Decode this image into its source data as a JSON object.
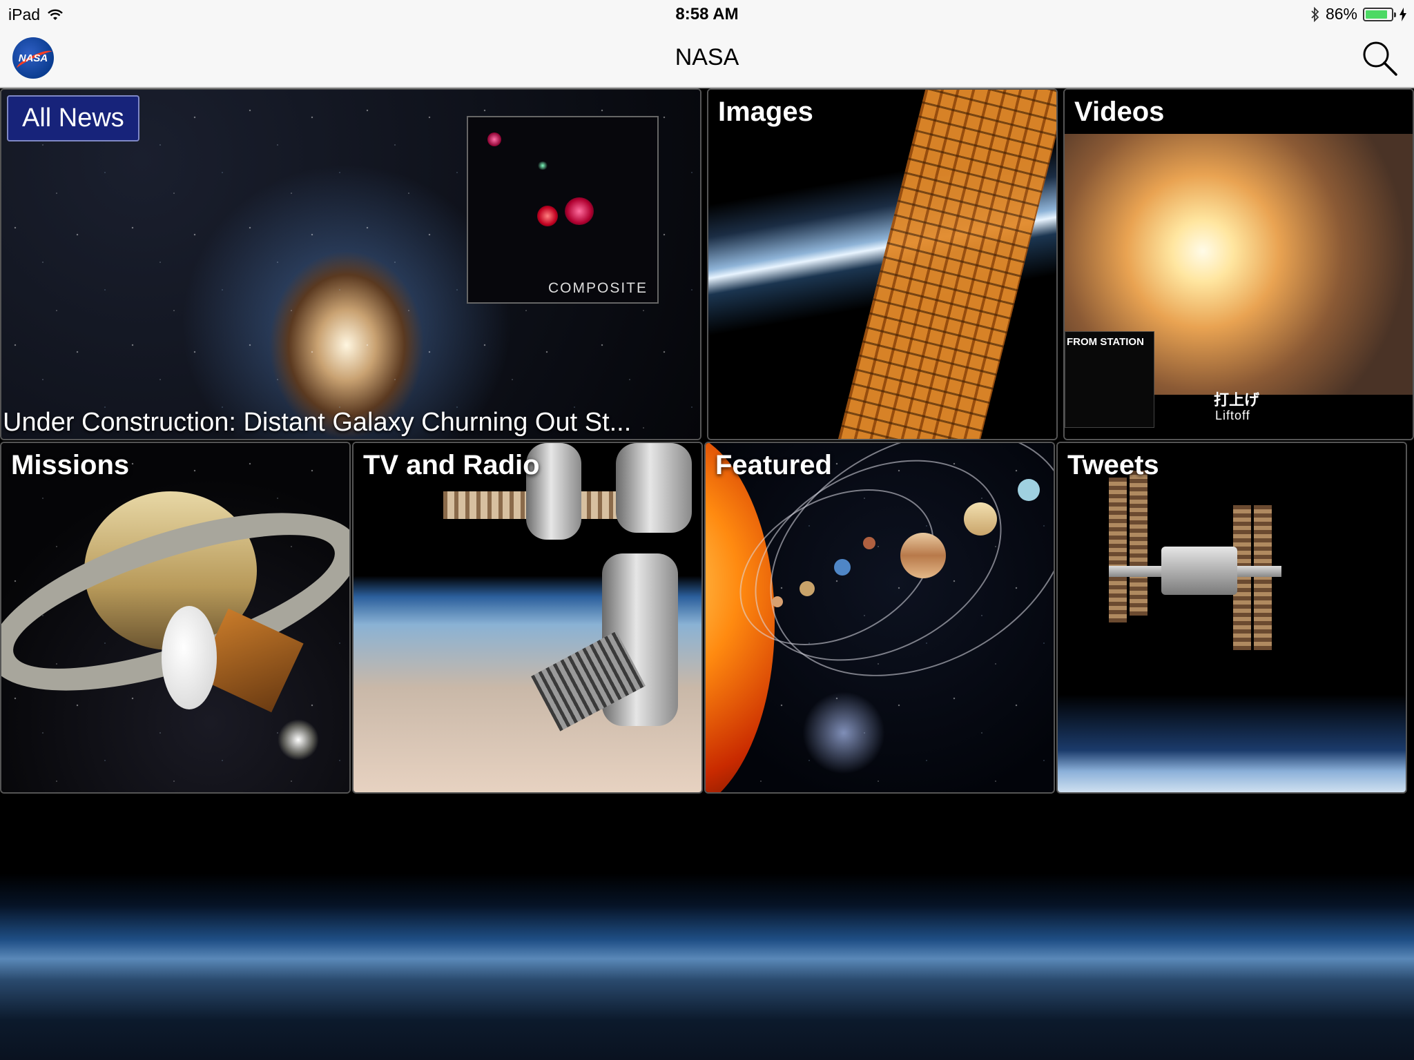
{
  "status_bar": {
    "device": "iPad",
    "time": "8:58 AM",
    "battery_percent": "86%",
    "battery_level": 0.86
  },
  "nav": {
    "logo_text": "NASA",
    "title": "NASA"
  },
  "tiles": {
    "news": {
      "badge": "All News",
      "headline": "Under Construction: Distant Galaxy Churning Out St...",
      "inset_label": "COMPOSITE"
    },
    "images": {
      "label": "Images"
    },
    "videos": {
      "label": "Videos",
      "inset_label": "FROM STATION",
      "subtitle_jp": "打上げ",
      "subtitle_en": "Liftoff"
    },
    "missions": {
      "label": "Missions"
    },
    "tv": {
      "label": "TV and Radio"
    },
    "featured": {
      "label": "Featured"
    },
    "tweets": {
      "label": "Tweets"
    }
  },
  "icons": {
    "wifi": "wifi-icon",
    "bluetooth": "bluetooth-icon",
    "battery": "battery-icon",
    "charging": "bolt-icon",
    "search": "search-icon"
  },
  "colors": {
    "bar_background": "#f7f7f7",
    "badge_background": "#17237a",
    "battery_fill": "#4cd964",
    "nasa_blue": "#0b3d91",
    "nasa_red": "#fc3d21"
  }
}
